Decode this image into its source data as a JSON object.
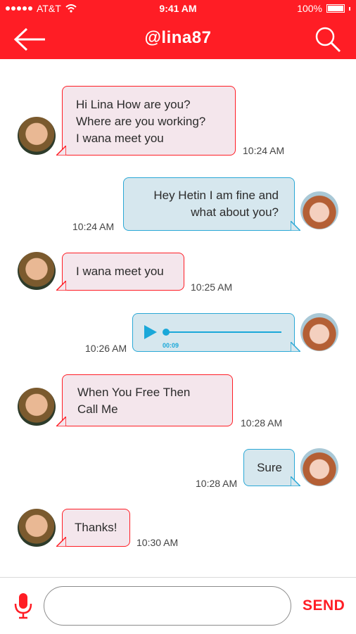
{
  "status_bar": {
    "carrier": "AT&T",
    "time": "9:41 AM",
    "battery": "100%"
  },
  "header": {
    "title": "@lina87"
  },
  "colors": {
    "accent": "#ff1d25",
    "incoming_bg": "#f4e6ec",
    "outgoing_bg": "#d6e7ee",
    "outgoing_border": "#2aa8d6",
    "voice_accent": "#1aa8d9"
  },
  "messages": [
    {
      "direction": "in",
      "lines": [
        "Hi Lina How are you?",
        "Where are you working?",
        "I wana meet you"
      ],
      "time": "10:24 AM"
    },
    {
      "direction": "out",
      "lines": [
        "Hey Hetin I am fine and",
        "what about you?"
      ],
      "time": "10:24 AM"
    },
    {
      "direction": "in",
      "lines": [
        "I wana meet you"
      ],
      "time": "10:25 AM"
    },
    {
      "direction": "out",
      "type": "voice",
      "duration": "00:09",
      "progress": 0.0,
      "time": "10:26 AM"
    },
    {
      "direction": "in",
      "lines": [
        "When You Free Then",
        "Call Me"
      ],
      "time": "10:28 AM"
    },
    {
      "direction": "out",
      "lines": [
        "Sure"
      ],
      "time": "10:28 AM"
    },
    {
      "direction": "in",
      "lines": [
        "Thanks!"
      ],
      "time": "10:30 AM"
    }
  ],
  "composer": {
    "input_value": "",
    "send_label": "SEND"
  },
  "icons": [
    "back-arrow-icon",
    "search-icon",
    "microphone-icon",
    "play-icon",
    "wifi-icon",
    "battery-icon"
  ]
}
